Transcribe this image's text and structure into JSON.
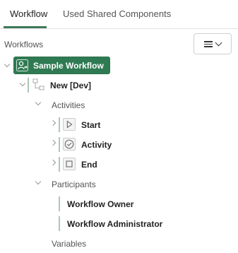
{
  "tabs": [
    {
      "label": "Workflow"
    },
    {
      "label": "Used Shared Components"
    }
  ],
  "tree": {
    "section_label": "Workflows",
    "root": {
      "label": "Sample Workflow",
      "icon": "workflow-user-icon"
    },
    "version": {
      "label": "New [Dev]",
      "icon": "workflow-version-icon"
    },
    "activities": {
      "label": "Activities",
      "items": [
        {
          "label": "Start",
          "icon": "play-icon"
        },
        {
          "label": "Activity",
          "icon": "check-circle-icon"
        },
        {
          "label": "End",
          "icon": "stop-square-icon"
        }
      ]
    },
    "participants": {
      "label": "Participants",
      "items": [
        {
          "label": "Workflow Owner"
        },
        {
          "label": "Workflow Administrator"
        }
      ]
    },
    "variables": {
      "label": "Variables"
    }
  },
  "colors": {
    "accent": "#3e7a5a",
    "selected_bg": "#2f7a52",
    "connector": "#a9c9b6"
  }
}
